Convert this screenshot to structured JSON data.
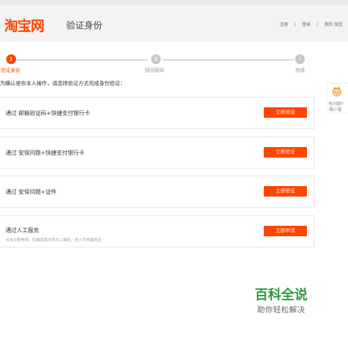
{
  "header": {
    "logo": "淘宝网",
    "page_title": "验证身份",
    "links": [
      "注册",
      "登录",
      "我的 淘宝"
    ]
  },
  "steps": [
    {
      "num": "1",
      "label": "验证身份",
      "active": true
    },
    {
      "num": "2",
      "label": "找回密码",
      "active": false
    },
    {
      "num": "✓",
      "label": "完成",
      "active": false
    }
  ],
  "instruction": "为确认是你本人操作，请选择验证方式完成身份验证：",
  "options": [
    {
      "title": "通过 邮箱验证码+快捷支付银行卡",
      "sub": "",
      "button": "立即验证"
    },
    {
      "title": "通过 安保问题+快捷支付银行卡",
      "sub": "",
      "button": "立即验证"
    },
    {
      "title": "通过 安保问题+证件",
      "sub": "",
      "button": "立即验证"
    },
    {
      "title": "通过人工服务",
      "sub": "点击立即申请，扫描页面中官方二维码，进入手机端验证",
      "button": "立即申请"
    }
  ],
  "side_widget": {
    "line1": "有问题?",
    "line2": "戳小蜜"
  },
  "watermark": {
    "main": "百科全说",
    "sub": "助你轻松解决"
  },
  "colors": {
    "accent": "#ff4400",
    "watermark": "#2e9b3d"
  }
}
